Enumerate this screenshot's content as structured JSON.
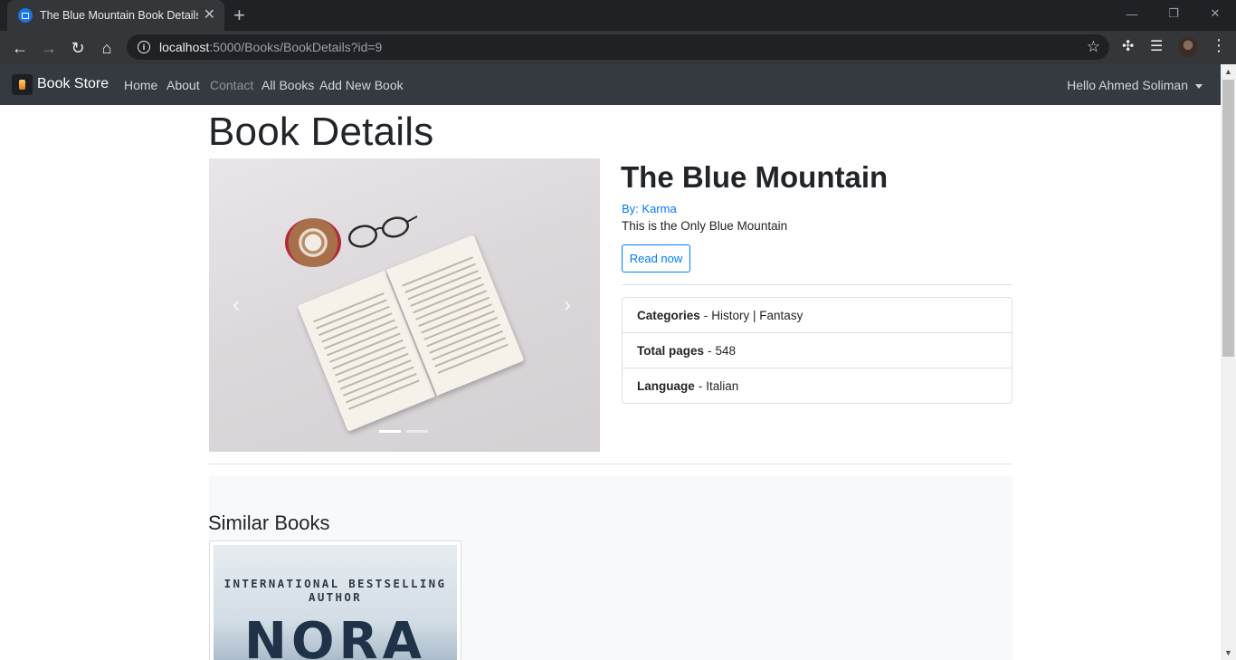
{
  "browser": {
    "tab_title": "The Blue Mountain Book Details |",
    "url_host": "localhost",
    "url_path": ":5000/Books/BookDetails?id=9"
  },
  "navbar": {
    "brand": "Book Store",
    "links": [
      "Home",
      "About",
      "Contact",
      "All Books",
      "Add New Book"
    ],
    "user_menu": "Hello Ahmed Soliman"
  },
  "page": {
    "title": "Book Details"
  },
  "book": {
    "title": "The Blue Mountain",
    "author": "By: Karma",
    "description": "This is the Only Blue Mountain",
    "read_button": "Read now",
    "details": {
      "categories_label": "Categories",
      "categories_value": "History | Fantasy",
      "pages_label": "Total pages",
      "pages_value": "548",
      "language_label": "Language",
      "language_value": "Italian",
      "separator": "-"
    }
  },
  "carousel": {
    "active_slide": 1,
    "total_slides": 2
  },
  "similar": {
    "title": "Similar Books",
    "card_cover_top": "INTERNATIONAL BESTSELLING AUTHOR",
    "card_cover_name": "NORA"
  },
  "colors": {
    "navbar_bg": "#343a40",
    "link_primary": "#007bff",
    "panel_bg": "#f8f9fa"
  }
}
